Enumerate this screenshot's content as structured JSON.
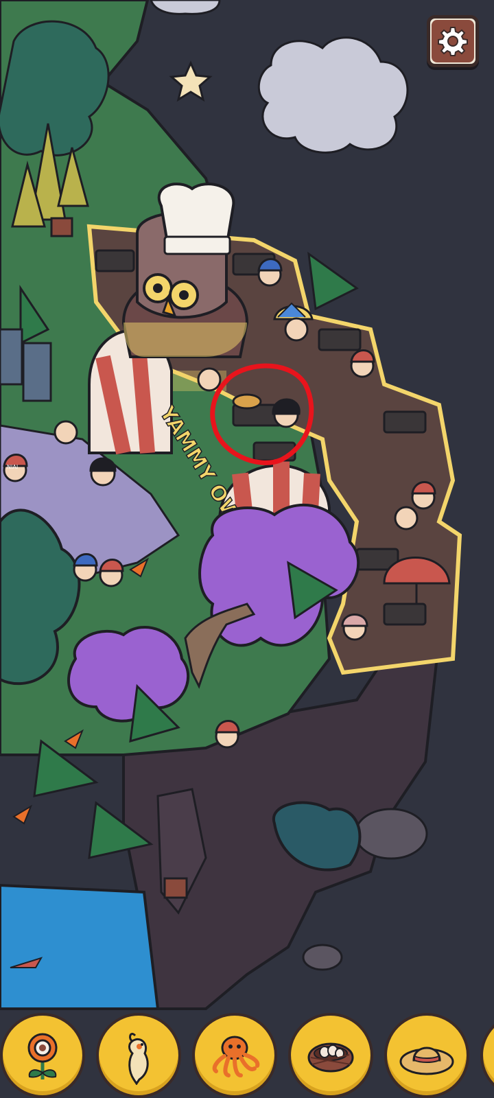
{
  "game": {
    "restaurant_sign": "YAMMY OWL",
    "cap_text": "NIAI"
  },
  "settings": {
    "icon": "gear-icon"
  },
  "toolbar": {
    "items": [
      {
        "name": "flower",
        "icon": "flower-icon"
      },
      {
        "name": "cockatiel",
        "icon": "cockatiel-icon"
      },
      {
        "name": "octopus",
        "icon": "octopus-icon"
      },
      {
        "name": "nest",
        "icon": "nest-icon"
      },
      {
        "name": "straw-hat",
        "icon": "straw-hat-icon"
      }
    ]
  },
  "colors": {
    "sky": "#30333f",
    "accent_yellow": "#f3c232",
    "highlight_circle": "#e8141c",
    "cloud": "#c9cad8",
    "owl_body": "#6b4848"
  }
}
